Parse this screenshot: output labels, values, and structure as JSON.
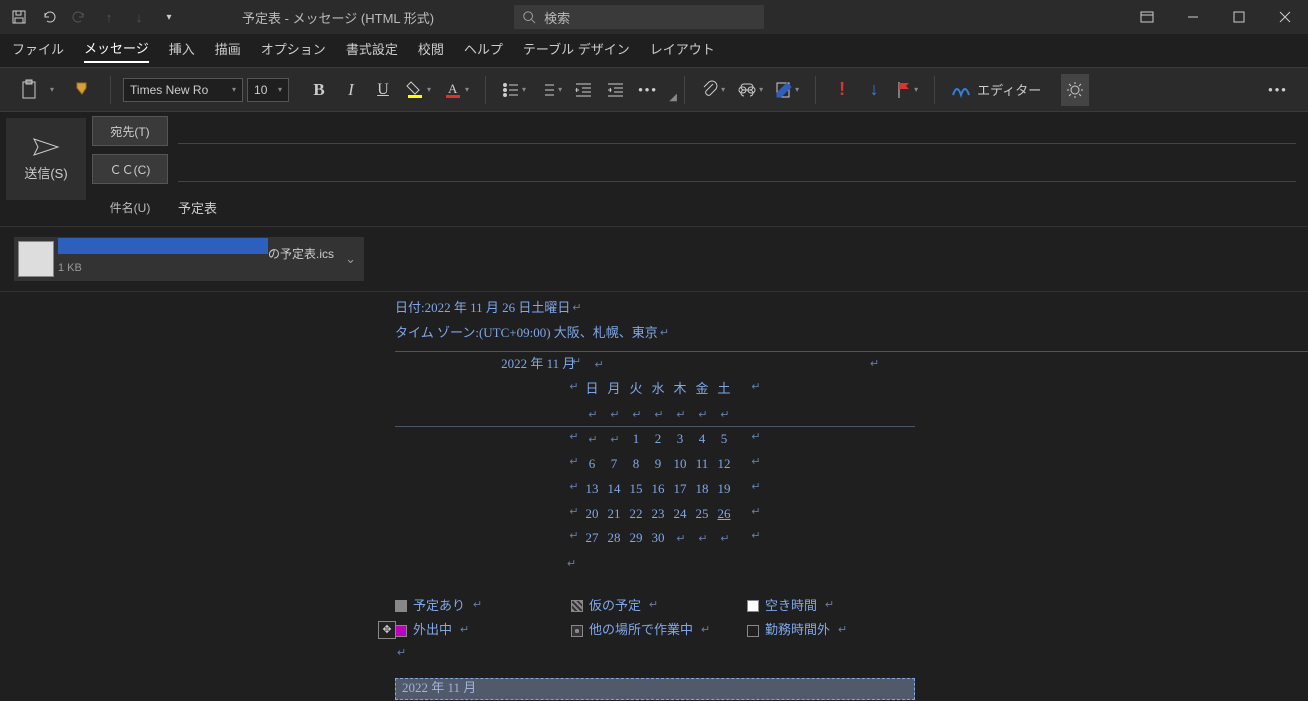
{
  "titlebar": {
    "title": "予定表  -  メッセージ (HTML 形式)",
    "search_placeholder": "検索"
  },
  "tabs": {
    "file": "ファイル",
    "message": "メッセージ",
    "insert": "挿入",
    "draw": "描画",
    "options": "オプション",
    "format": "書式設定",
    "review": "校閲",
    "help": "ヘルプ",
    "table_design": "テーブル デザイン",
    "layout": "レイアウト"
  },
  "ribbon": {
    "font_name": "Times New Ro",
    "font_size": "10",
    "editor_label": "エディター"
  },
  "composer": {
    "send": "送信(S)",
    "to": "宛先(T)",
    "cc": "ＣＣ(C)",
    "subject_label": "件名(U)",
    "subject_value": "予定表"
  },
  "attachment": {
    "name_suffix": "の予定表.ics",
    "size": "1 KB"
  },
  "body": {
    "date_label": "日付: ",
    "date_value": "2022 年 11 月 26 日土曜日",
    "tz_label": "タイム ゾーン: ",
    "tz_value": "(UTC+09:00) 大阪、札幌、東京",
    "cal_title": "2022 年  11 月",
    "dow": [
      "日",
      "月",
      "火",
      "水",
      "木",
      "金",
      "土"
    ],
    "weeks": [
      [
        "",
        "",
        "1",
        "2",
        "3",
        "4",
        "5"
      ],
      [
        "6",
        "7",
        "8",
        "9",
        "10",
        "11",
        "12"
      ],
      [
        "13",
        "14",
        "15",
        "16",
        "17",
        "18",
        "19"
      ],
      [
        "20",
        "21",
        "22",
        "23",
        "24",
        "25",
        "26"
      ],
      [
        "27",
        "28",
        "29",
        "30",
        "",
        "",
        ""
      ]
    ],
    "today": "26",
    "legend": {
      "busy": "予定あり",
      "tentative": "仮の予定",
      "free": "空き時間",
      "oof": "外出中",
      "elsewhere": "他の場所で作業中",
      "outside": "勤務時間外"
    },
    "table_header": "2022 年  11 月"
  }
}
